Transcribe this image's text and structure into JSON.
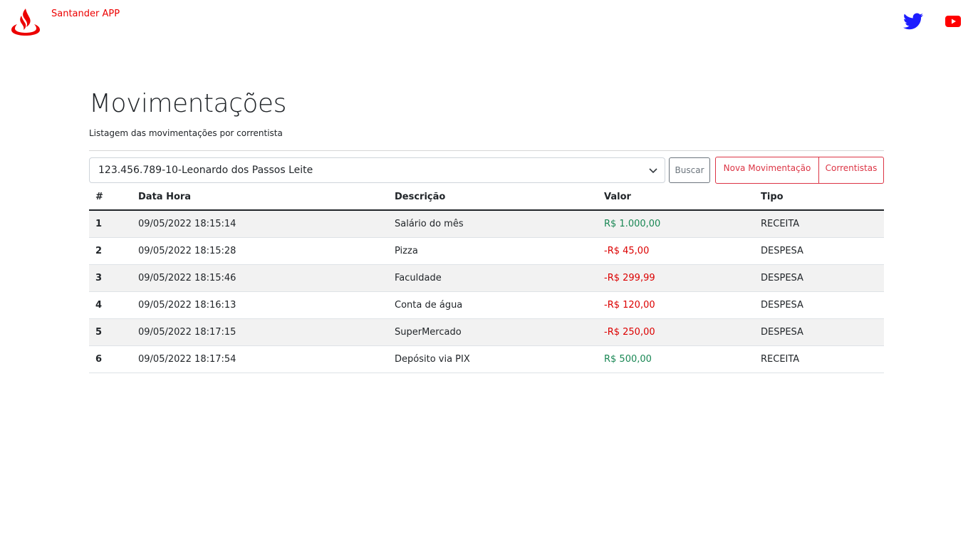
{
  "header": {
    "brand": "Santander APP",
    "colors": {
      "brand": "#ec0000",
      "twitter": "#1d1dff",
      "youtube": "#ff0000"
    },
    "social": [
      "twitter-icon",
      "youtube-icon"
    ]
  },
  "main": {
    "title": "Movimentações",
    "subtitle": "Listagem das movimentações por correntista"
  },
  "controls": {
    "account_select_value": "123.456.789-10-Leonardo dos Passos Leite",
    "search_label": "Buscar",
    "new_movement_label": "Nova Movimentação",
    "account_holders_label": "Correntistas"
  },
  "table": {
    "headers": {
      "idx": "#",
      "datetime": "Data Hora",
      "description": "Descrição",
      "value": "Valor",
      "type": "Tipo"
    },
    "rows": [
      {
        "idx": "1",
        "datetime": "09/05/2022 18:15:14",
        "description": "Salário do mês",
        "value": "R$ 1.000,00",
        "type": "RECEITA"
      },
      {
        "idx": "2",
        "datetime": "09/05/2022 18:15:28",
        "description": "Pizza",
        "value": "-R$ 45,00",
        "type": "DESPESA"
      },
      {
        "idx": "3",
        "datetime": "09/05/2022 18:15:46",
        "description": "Faculdade",
        "value": "-R$ 299,99",
        "type": "DESPESA"
      },
      {
        "idx": "4",
        "datetime": "09/05/2022 18:16:13",
        "description": "Conta de água",
        "value": "-R$ 120,00",
        "type": "DESPESA"
      },
      {
        "idx": "5",
        "datetime": "09/05/2022 18:17:15",
        "description": "SuperMercado",
        "value": "-R$ 250,00",
        "type": "DESPESA"
      },
      {
        "idx": "6",
        "datetime": "09/05/2022 18:17:54",
        "description": "Depósito via PIX",
        "value": "R$ 500,00",
        "type": "RECEITA"
      }
    ]
  }
}
